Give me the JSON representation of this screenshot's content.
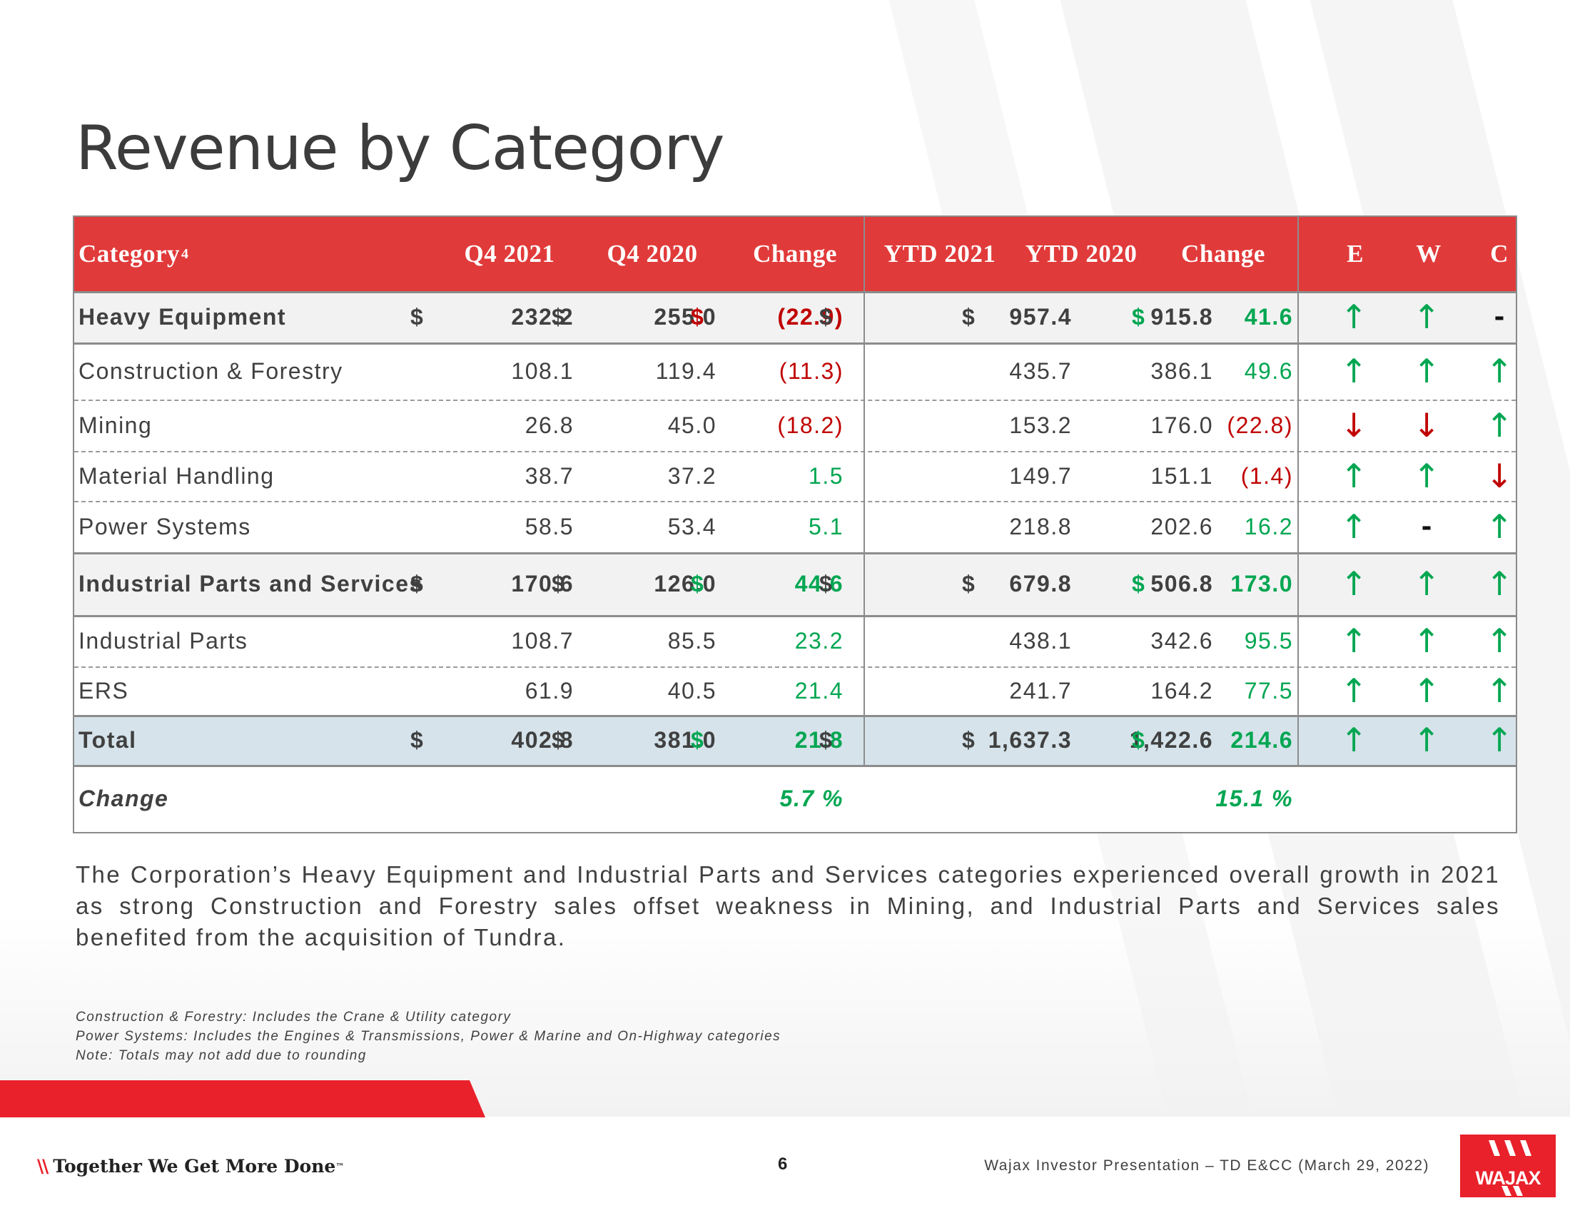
{
  "slide": {
    "title": "Revenue by Category",
    "page_number": "6",
    "footer": "Wajax Investor Presentation – TD E&CC (March 29, 2022)",
    "tagline": "Together We Get More Done",
    "tagline_mark": "™",
    "tagline_slashes": "\\\\",
    "logo": "WAJAX",
    "brand_color": "#e8212b"
  },
  "table": {
    "headers": {
      "category": "Category",
      "category_sup": "4",
      "q4_2021": "Q4 2021",
      "q4_2020": "Q4 2020",
      "q_change": "Change",
      "ytd_2021": "YTD 2021",
      "ytd_2020": "YTD 2020",
      "ytd_change": "Change",
      "e": "E",
      "w": "W",
      "c": "C"
    },
    "rows": [
      {
        "label": "Heavy Equipment",
        "q4_2021": "232.2",
        "q4_2020": "255.0",
        "q_change": "(22.9)",
        "ytd_2021": "957.4",
        "ytd_2020": "915.8",
        "ytd_change": "41.6",
        "e": "↑",
        "w": "↑",
        "c": "-",
        "dollar": "$"
      },
      {
        "label": "Construction & Forestry",
        "q4_2021": "108.1",
        "q4_2020": "119.4",
        "q_change": "(11.3)",
        "ytd_2021": "435.7",
        "ytd_2020": "386.1",
        "ytd_change": "49.6",
        "e": "↑",
        "w": "↑",
        "c": "↑"
      },
      {
        "label": "Mining",
        "q4_2021": "26.8",
        "q4_2020": "45.0",
        "q_change": "(18.2)",
        "ytd_2021": "153.2",
        "ytd_2020": "176.0",
        "ytd_change": "(22.8)",
        "e": "↓",
        "w": "↓",
        "c": "↑"
      },
      {
        "label": "Material Handling",
        "q4_2021": "38.7",
        "q4_2020": "37.2",
        "q_change": "1.5",
        "ytd_2021": "149.7",
        "ytd_2020": "151.1",
        "ytd_change": "(1.4)",
        "e": "↑",
        "w": "↑",
        "c": "↓"
      },
      {
        "label": "Power Systems",
        "q4_2021": "58.5",
        "q4_2020": "53.4",
        "q_change": "5.1",
        "ytd_2021": "218.8",
        "ytd_2020": "202.6",
        "ytd_change": "16.2",
        "e": "↑",
        "w": "-",
        "c": "↑"
      },
      {
        "label": "Industrial Parts and Services",
        "q4_2021": "170.6",
        "q4_2020": "126.0",
        "q_change": "44.6",
        "ytd_2021": "679.8",
        "ytd_2020": "506.8",
        "ytd_change": "173.0",
        "e": "↑",
        "w": "↑",
        "c": "↑",
        "dollar": "$"
      },
      {
        "label": "Industrial Parts",
        "q4_2021": "108.7",
        "q4_2020": "85.5",
        "q_change": "23.2",
        "ytd_2021": "438.1",
        "ytd_2020": "342.6",
        "ytd_change": "95.5",
        "e": "↑",
        "w": "↑",
        "c": "↑"
      },
      {
        "label": "ERS",
        "q4_2021": "61.9",
        "q4_2020": "40.5",
        "q_change": "21.4",
        "ytd_2021": "241.7",
        "ytd_2020": "164.2",
        "ytd_change": "77.5",
        "e": "↑",
        "w": "↑",
        "c": "↑"
      },
      {
        "label": "Total",
        "q4_2021": "402.8",
        "q4_2020": "381.0",
        "q_change": "21.8",
        "ytd_2021": "1,637.3",
        "ytd_2020": "1,422.6",
        "ytd_change": "214.6",
        "e": "↑",
        "w": "↑",
        "c": "↑",
        "dollar": "$"
      }
    ],
    "change_row": {
      "label": "Change",
      "q_change_pct": "5.7 %",
      "ytd_change_pct": "15.1 %"
    }
  },
  "summary": "The Corporation’s Heavy Equipment and Industrial Parts and Services categories experienced overall growth in 2021 as strong Construction and Forestry sales offset weakness in Mining, and Industrial Parts and Services sales benefited from the acquisition of Tundra.",
  "notes": [
    "Construction & Forestry: Includes the Crane & Utility category",
    "Power Systems: Includes the Engines & Transmissions, Power & Marine and On-Highway categories",
    "Note: Totals may not add due to rounding"
  ],
  "colors": {
    "header_red": "#e13a3a",
    "positive_green": "#00a651",
    "negative_red": "#c00000",
    "total_row": "#d6e3ea"
  }
}
